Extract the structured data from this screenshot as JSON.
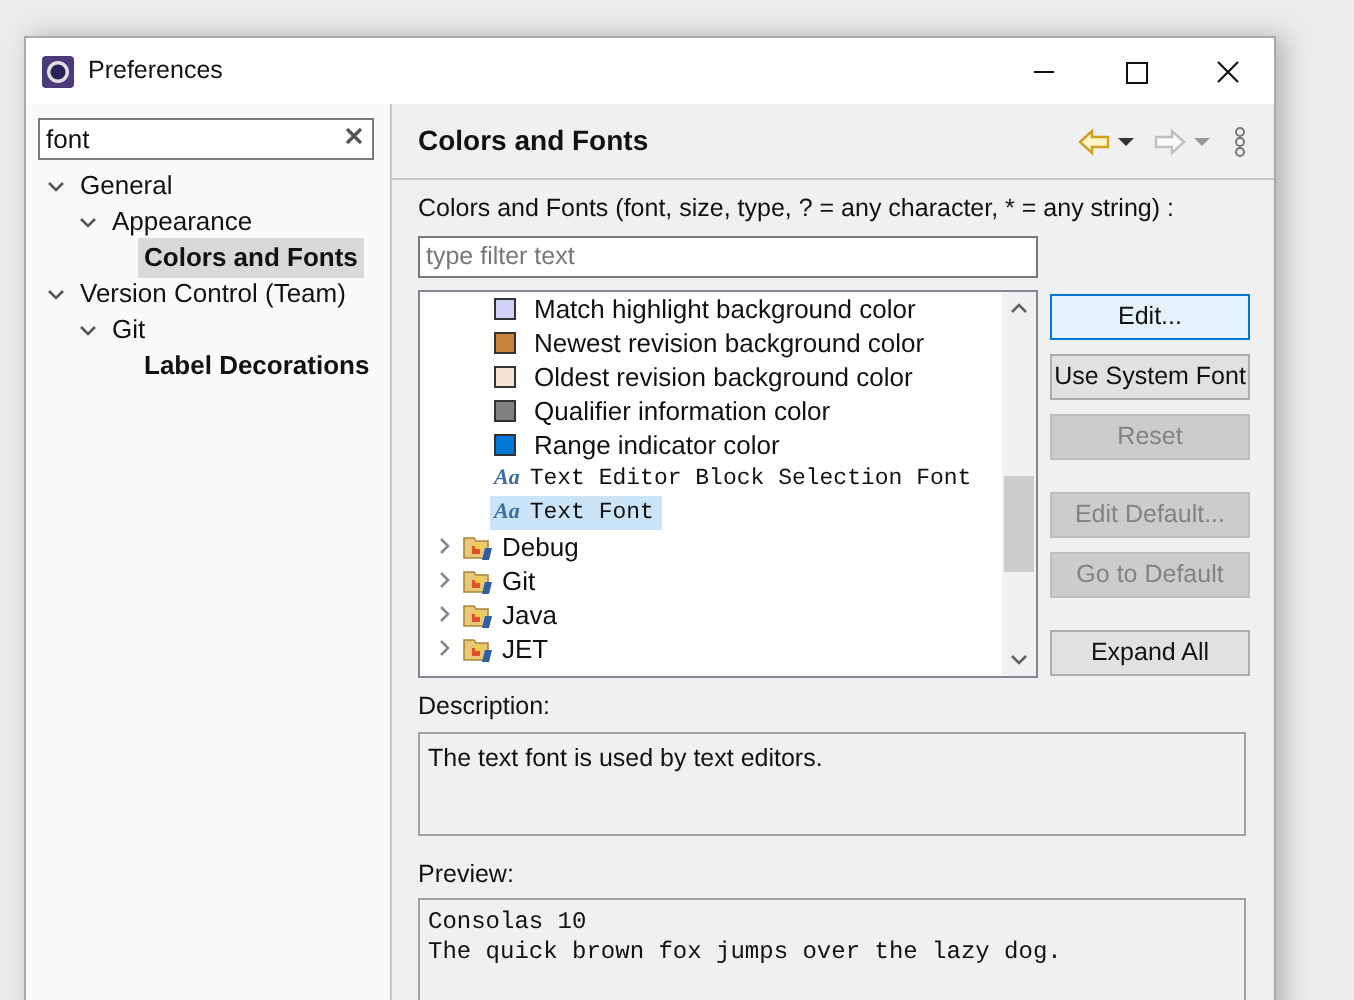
{
  "window": {
    "title": "Preferences"
  },
  "search": {
    "value": "font"
  },
  "nav_tree": [
    {
      "label": "General",
      "expanded": true,
      "selected": false,
      "match": false,
      "children": [
        {
          "label": "Appearance",
          "expanded": true,
          "selected": false,
          "match": false,
          "children": [
            {
              "label": "Colors and Fonts",
              "selected": true,
              "match": true
            }
          ]
        }
      ]
    },
    {
      "label": "Version Control (Team)",
      "expanded": true,
      "selected": false,
      "match": false,
      "children": [
        {
          "label": "Git",
          "expanded": true,
          "selected": false,
          "match": false,
          "children": [
            {
              "label": "Label Decorations",
              "selected": false,
              "match": true
            }
          ]
        }
      ]
    }
  ],
  "page": {
    "title": "Colors and Fonts",
    "filter_label": "Colors and Fonts (font, size, type, ? = any character, * = any string) :",
    "filter": {
      "placeholder": "type filter text"
    },
    "items": [
      {
        "kind": "color",
        "label": "Match highlight background color",
        "color": "#d0d0f8",
        "selected": false
      },
      {
        "kind": "color",
        "label": "Newest revision background color",
        "color": "#c8843c",
        "selected": false
      },
      {
        "kind": "color",
        "label": "Oldest revision background color",
        "color": "#f4e4d8",
        "selected": false
      },
      {
        "kind": "color",
        "label": "Qualifier information color",
        "color": "#808080",
        "selected": false
      },
      {
        "kind": "color",
        "label": "Range indicator color",
        "color": "#0078d7",
        "selected": false
      },
      {
        "kind": "font",
        "icon": "Aa",
        "label": "Text Editor Block Selection Font",
        "selected": false
      },
      {
        "kind": "font",
        "icon": "Aa",
        "label": "Text Font",
        "selected": true
      },
      {
        "kind": "category",
        "label": "Debug",
        "expanded": false,
        "selected": false
      },
      {
        "kind": "category",
        "label": "Git",
        "expanded": false,
        "selected": false
      },
      {
        "kind": "category",
        "label": "Java",
        "expanded": false,
        "selected": false
      },
      {
        "kind": "category",
        "label": "JET",
        "expanded": false,
        "selected": false
      }
    ],
    "buttons": [
      {
        "label": "Edit...",
        "disabled": false,
        "focused": true
      },
      {
        "label": "Use System Font",
        "disabled": false,
        "focused": false
      },
      {
        "label": "Reset",
        "disabled": true,
        "focused": false
      },
      {
        "label": "Edit Default...",
        "disabled": true,
        "focused": false
      },
      {
        "label": "Go to Default",
        "disabled": true,
        "focused": false
      },
      {
        "label": "Expand All",
        "disabled": false,
        "focused": false
      }
    ],
    "description_label": "Description:",
    "description": "The text font is used by text editors.",
    "preview_label": "Preview:",
    "preview": [
      "Consolas 10",
      "The quick brown fox jumps over the lazy dog."
    ]
  }
}
